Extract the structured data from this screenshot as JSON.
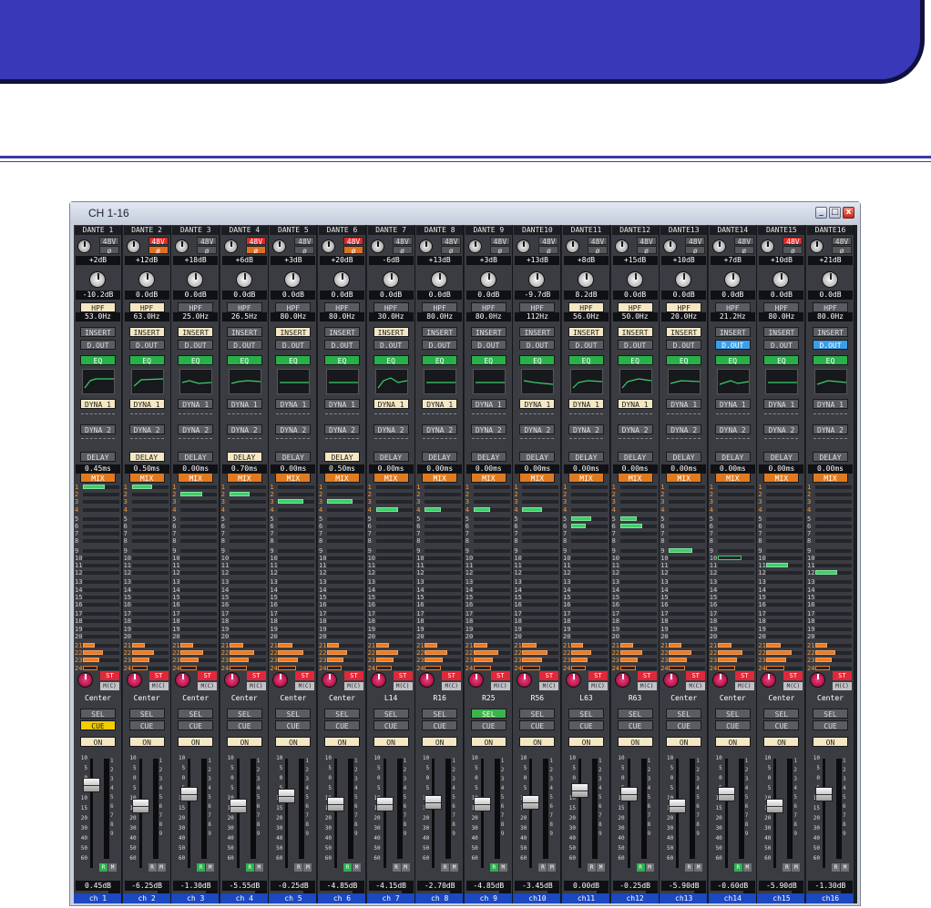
{
  "window": {
    "title": "CH 1-16",
    "min": "_",
    "max": "□",
    "close": "x"
  },
  "labels": {
    "phantom": "48V",
    "phase": "ø",
    "hpf": "HPF",
    "insert": "INSERT",
    "dout": "D.OUT",
    "eq": "EQ",
    "dyna1": "DYNA 1",
    "dyna2": "DYNA 2",
    "delay": "DELAY",
    "mix": "MIX",
    "st": "ST",
    "mc": "M(C)",
    "sel": "SEL",
    "cue": "CUE",
    "on": "ON",
    "r": "R",
    "m": "M"
  },
  "fader_scale": [
    "10",
    "5",
    "0",
    "5",
    "10",
    "15",
    "20",
    "30",
    "40",
    "50",
    "60"
  ],
  "meter_scale": [
    "1",
    "2",
    "3",
    "4",
    "5",
    "6",
    "7",
    "8",
    "9"
  ],
  "mix_rows": [
    "1",
    "2",
    "3",
    "4",
    "5",
    "6",
    "7",
    "8",
    "9",
    "10",
    "11",
    "12",
    "13",
    "14",
    "15",
    "16",
    "17",
    "18",
    "19",
    "20",
    "21",
    "22",
    "23",
    "24"
  ],
  "channels": [
    {
      "port": "DANTE 1",
      "p48": false,
      "phase": false,
      "gain": "+2dB",
      "pt": "-10.2dB",
      "hpf": "53.0Hz",
      "hpf_on": true,
      "ins": false,
      "dout": false,
      "dyna1": true,
      "delay": false,
      "delay_val": "0.45ms",
      "mix": [
        [
          0,
          0.6,
          "g"
        ]
      ],
      "pan": "Center",
      "sel": false,
      "cue": true,
      "num": "1",
      "level": "0.45dB",
      "name": "ch 1",
      "fader": 0.8
    },
    {
      "port": "DANTE 2",
      "p48": true,
      "phase": true,
      "gain": "+12dB",
      "pt": "0.0dB",
      "hpf": "63.0Hz",
      "hpf_on": true,
      "ins": true,
      "dout": false,
      "dyna1": true,
      "delay": true,
      "delay_val": "0.50ms",
      "mix": [
        [
          0,
          0.55,
          "g"
        ]
      ],
      "pan": "Center",
      "sel": false,
      "cue": false,
      "num": "2",
      "level": "-6.25dB",
      "name": "ch 2",
      "fader": 0.58
    },
    {
      "port": "DANTE 3",
      "p48": false,
      "phase": false,
      "gain": "+18dB",
      "pt": "0.0dB",
      "hpf": "25.0Hz",
      "hpf_on": false,
      "ins": true,
      "dout": false,
      "dyna1": false,
      "delay": false,
      "delay_val": "0.00ms",
      "mix": [
        [
          1,
          0.6,
          "g"
        ]
      ],
      "pan": "Center",
      "sel": false,
      "cue": false,
      "num": "3",
      "level": "-1.30dB",
      "name": "ch 3",
      "fader": 0.7
    },
    {
      "port": "DANTE 4",
      "p48": true,
      "phase": true,
      "gain": "+6dB",
      "pt": "0.0dB",
      "hpf": "26.5Hz",
      "hpf_on": false,
      "ins": false,
      "dout": false,
      "dyna1": false,
      "delay": true,
      "delay_val": "0.70ms",
      "mix": [
        [
          1,
          0.55,
          "g"
        ]
      ],
      "pan": "Center",
      "sel": false,
      "cue": false,
      "num": "4",
      "level": "-5.55dB",
      "name": "ch 4",
      "fader": 0.58
    },
    {
      "port": "DANTE 5",
      "p48": false,
      "phase": false,
      "gain": "+3dB",
      "pt": "0.0dB",
      "hpf": "80.0Hz",
      "hpf_on": false,
      "ins": true,
      "dout": false,
      "dyna1": false,
      "delay": false,
      "delay_val": "0.00ms",
      "mix": [
        [
          2,
          0.7,
          "g"
        ]
      ],
      "pan": "Center",
      "sel": false,
      "cue": false,
      "num": "5",
      "level": "-0.25dB",
      "name": "ch 5",
      "fader": 0.68
    },
    {
      "port": "DANTE 6",
      "p48": true,
      "phase": true,
      "gain": "+20dB",
      "pt": "0.0dB",
      "hpf": "80.0Hz",
      "hpf_on": false,
      "ins": false,
      "dout": false,
      "dyna1": false,
      "delay": true,
      "delay_val": "0.50ms",
      "mix": [
        [
          2,
          0.7,
          "g"
        ]
      ],
      "pan": "Center",
      "sel": false,
      "cue": false,
      "num": "6",
      "level": "-4.85dB",
      "name": "ch 6",
      "fader": 0.6
    },
    {
      "port": "DANTE 7",
      "p48": false,
      "phase": false,
      "gain": "-6dB",
      "pt": "0.0dB",
      "hpf": "30.0Hz",
      "hpf_on": false,
      "ins": true,
      "dout": false,
      "dyna1": true,
      "delay": false,
      "delay_val": "0.00ms",
      "mix": [
        [
          3,
          0.6,
          "g"
        ]
      ],
      "pan": "L14",
      "sel": false,
      "cue": false,
      "num": "7",
      "level": "-4.15dB",
      "name": "ch 7",
      "fader": 0.6
    },
    {
      "port": "DANTE 8",
      "p48": false,
      "phase": false,
      "gain": "+13dB",
      "pt": "0.0dB",
      "hpf": "80.0Hz",
      "hpf_on": false,
      "ins": false,
      "dout": false,
      "dyna1": true,
      "delay": false,
      "delay_val": "0.00ms",
      "mix": [
        [
          3,
          0.45,
          "g"
        ]
      ],
      "pan": "R16",
      "sel": false,
      "cue": false,
      "num": "8",
      "level": "-2.70dB",
      "name": "ch 8",
      "fader": 0.62
    },
    {
      "port": "DANTE 9",
      "p48": false,
      "phase": false,
      "gain": "+3dB",
      "pt": "0.0dB",
      "hpf": "80.0Hz",
      "hpf_on": false,
      "ins": false,
      "dout": false,
      "dyna1": false,
      "delay": false,
      "delay_val": "0.00ms",
      "mix": [
        [
          3,
          0.45,
          "g"
        ]
      ],
      "pan": "R25",
      "sel": true,
      "cue": false,
      "num": "9",
      "level": "-4.85dB",
      "name": "ch 9",
      "fader": 0.6
    },
    {
      "port": "DANTE10",
      "p48": false,
      "phase": false,
      "gain": "+13dB",
      "pt": "-9.7dB",
      "hpf": "112Hz",
      "hpf_on": false,
      "ins": false,
      "dout": false,
      "dyna1": true,
      "delay": false,
      "delay_val": "0.00ms",
      "mix": [
        [
          3,
          0.55,
          "g"
        ]
      ],
      "pan": "R56",
      "sel": false,
      "cue": false,
      "num": "10",
      "level": "-3.45dB",
      "name": "ch10",
      "fader": 0.62
    },
    {
      "port": "DANTE11",
      "p48": false,
      "phase": false,
      "gain": "+8dB",
      "pt": "8.2dB",
      "hpf": "56.0Hz",
      "hpf_on": true,
      "ins": true,
      "dout": false,
      "dyna1": true,
      "delay": false,
      "delay_val": "0.00ms",
      "mix": [
        [
          4,
          0.55,
          "g"
        ],
        [
          5,
          0.4,
          "g"
        ]
      ],
      "pan": "L63",
      "sel": false,
      "cue": false,
      "num": "11",
      "level": "0.00dB",
      "name": "ch11",
      "fader": 0.74
    },
    {
      "port": "DANTE12",
      "p48": false,
      "phase": false,
      "gain": "+15dB",
      "pt": "0.0dB",
      "hpf": "50.0Hz",
      "hpf_on": true,
      "ins": true,
      "dout": false,
      "dyna1": true,
      "delay": false,
      "delay_val": "0.00ms",
      "mix": [
        [
          4,
          0.45,
          "g"
        ],
        [
          5,
          0.6,
          "g"
        ]
      ],
      "pan": "R63",
      "sel": false,
      "cue": false,
      "num": "12",
      "level": "-0.25dB",
      "name": "ch12",
      "fader": 0.7
    },
    {
      "port": "DANTE13",
      "p48": false,
      "phase": false,
      "gain": "+10dB",
      "pt": "0.0dB",
      "hpf": "20.0Hz",
      "hpf_on": true,
      "ins": true,
      "dout": false,
      "dyna1": false,
      "delay": false,
      "delay_val": "0.00ms",
      "mix": [
        [
          8,
          0.65,
          "g"
        ]
      ],
      "pan": "Center",
      "sel": false,
      "cue": false,
      "num": "13",
      "level": "-5.90dB",
      "name": "ch13",
      "fader": 0.58
    },
    {
      "port": "DANTE14",
      "p48": false,
      "phase": false,
      "gain": "+7dB",
      "pt": "0.0dB",
      "hpf": "21.2Hz",
      "hpf_on": false,
      "ins": false,
      "dout": true,
      "dyna1": false,
      "delay": false,
      "delay_val": "0.00ms",
      "mix": [
        [
          9,
          0.65,
          "gh"
        ]
      ],
      "pan": "Center",
      "sel": false,
      "cue": false,
      "num": "14",
      "level": "-0.60dB",
      "name": "ch14",
      "fader": 0.7
    },
    {
      "port": "DANTE15",
      "p48": true,
      "phase": false,
      "gain": "+10dB",
      "pt": "0.0dB",
      "hpf": "80.0Hz",
      "hpf_on": false,
      "ins": false,
      "dout": false,
      "dyna1": false,
      "delay": false,
      "delay_val": "0.00ms",
      "mix": [
        [
          10,
          0.6,
          "g"
        ]
      ],
      "pan": "Center",
      "sel": false,
      "cue": false,
      "num": "15",
      "level": "-5.90dB",
      "name": "ch15",
      "fader": 0.58
    },
    {
      "port": "DANTE16",
      "p48": false,
      "phase": false,
      "gain": "+21dB",
      "pt": "0.0dB",
      "hpf": "80.0Hz",
      "hpf_on": false,
      "ins": false,
      "dout": true,
      "dyna1": false,
      "delay": false,
      "delay_val": "0.00ms",
      "mix": [
        [
          11,
          0.6,
          "g"
        ]
      ],
      "pan": "Center",
      "sel": false,
      "cue": false,
      "num": "16",
      "level": "-1.30dB",
      "name": "ch16",
      "fader": 0.7
    }
  ]
}
